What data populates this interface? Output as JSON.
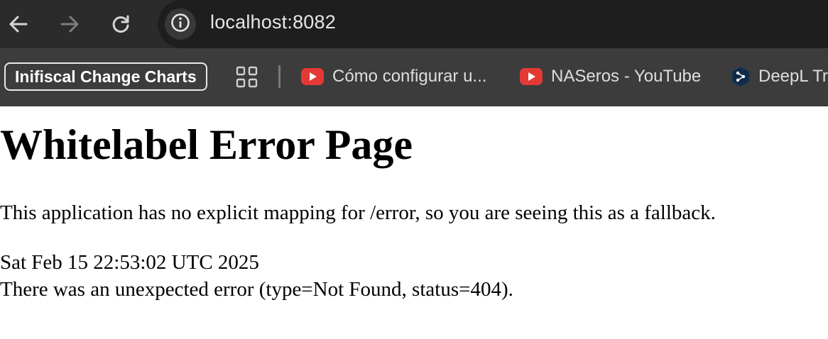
{
  "browser": {
    "url": "localhost:8082",
    "icons": {
      "back": "arrow-left-icon",
      "forward": "arrow-right-icon",
      "reload": "reload-icon",
      "site_info": "info-circle-icon"
    },
    "colors": {
      "toolbar": "#2b2b2b",
      "omnibox": "#1e1e1e",
      "bookmarks_bar": "#3c3c3c",
      "youtube_red": "#e53935"
    }
  },
  "bookmarks": {
    "folder_label": "Inifiscal Change Charts",
    "items": [
      {
        "label": "Cómo configurar u...",
        "icon": "youtube-icon"
      },
      {
        "label": "NASeros - YouTube",
        "icon": "youtube-icon"
      },
      {
        "label": "DeepL Tr",
        "icon": "deepl-icon"
      }
    ]
  },
  "page": {
    "title": "Whitelabel Error Page",
    "message": "This application has no explicit mapping for /error, so you are seeing this as a fallback.",
    "timestamp": "Sat Feb 15 22:53:02 UTC 2025",
    "error_detail": "There was an unexpected error (type=Not Found, status=404)."
  }
}
